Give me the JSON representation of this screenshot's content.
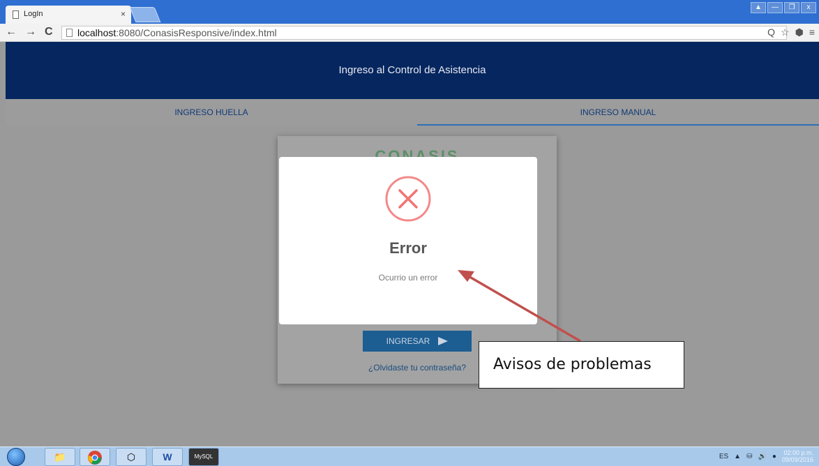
{
  "browser": {
    "tab_title": "LogIn",
    "tab_close": "×",
    "url_host": "localhost",
    "url_path": ":8080/ConasisResponsive/index.html",
    "back": "←",
    "forward": "→",
    "reload": "C",
    "window_buttons": [
      "▲",
      "—",
      "❐",
      "x"
    ],
    "toolbar_icons": [
      "Q",
      "☆",
      "⬢",
      "≡"
    ]
  },
  "app": {
    "header_title": "Ingreso al Control de Asistencia",
    "tabs": [
      {
        "label": "INGRESO HUELLA",
        "active": false
      },
      {
        "label": "INGRESO MANUAL",
        "active": true
      }
    ],
    "logo_text": "CONASIS",
    "submit_label": "INGRESAR",
    "forgot_link": "¿Olvidaste tu contraseña?"
  },
  "modal": {
    "icon": "error-x-icon",
    "title": "Error",
    "message": "Ocurrio un error",
    "icon_color": "#f27474"
  },
  "annotation": {
    "label": "Avisos de problemas",
    "arrow_color": "#c0504d"
  },
  "taskbar": {
    "apps": [
      "explorer",
      "chrome",
      "virtualbox",
      "word",
      "mysql"
    ],
    "language": "ES",
    "time": "02:00 p.m.",
    "date": "09/09/2016"
  },
  "colors": {
    "header_bg": "#06265f",
    "tab_active_border": "#2d6fb7",
    "button_bg": "#1c5d92"
  }
}
